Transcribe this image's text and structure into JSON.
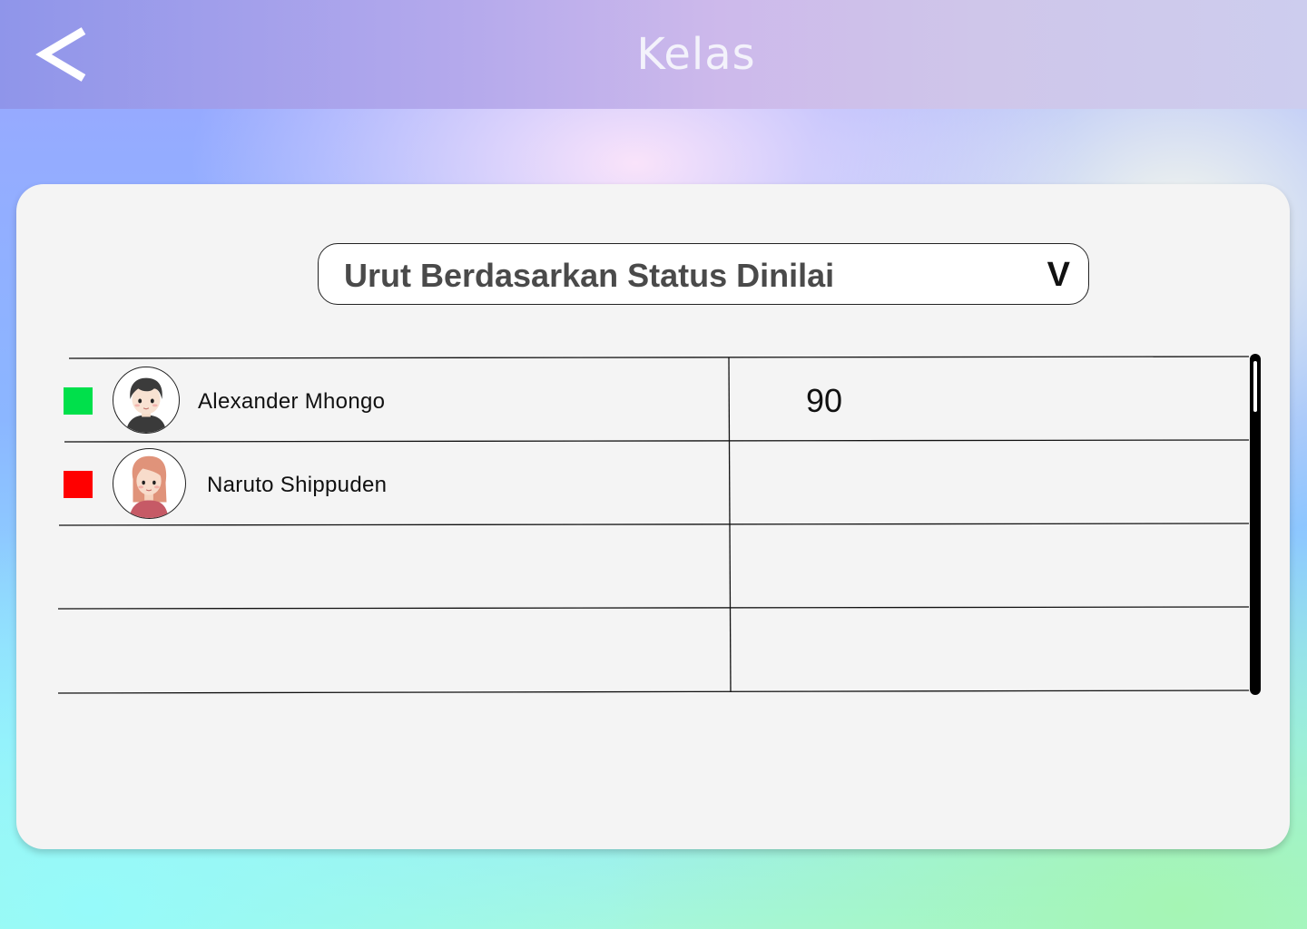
{
  "header": {
    "title": "Kelas",
    "back_icon": "chevron-left-icon"
  },
  "sort": {
    "label": "Urut Berdasarkan Status Dinilai",
    "chevron": "V"
  },
  "students": [
    {
      "name": "Alexander Mhongo",
      "score": "90",
      "status_color": "#00e04b",
      "avatar": "boy-avatar-icon"
    },
    {
      "name": "Naruto Shippuden",
      "score": "",
      "status_color": "#ff0000",
      "avatar": "girl-avatar-icon"
    }
  ],
  "colors": {
    "graded": "#00e04b",
    "ungraded": "#ff0000"
  }
}
